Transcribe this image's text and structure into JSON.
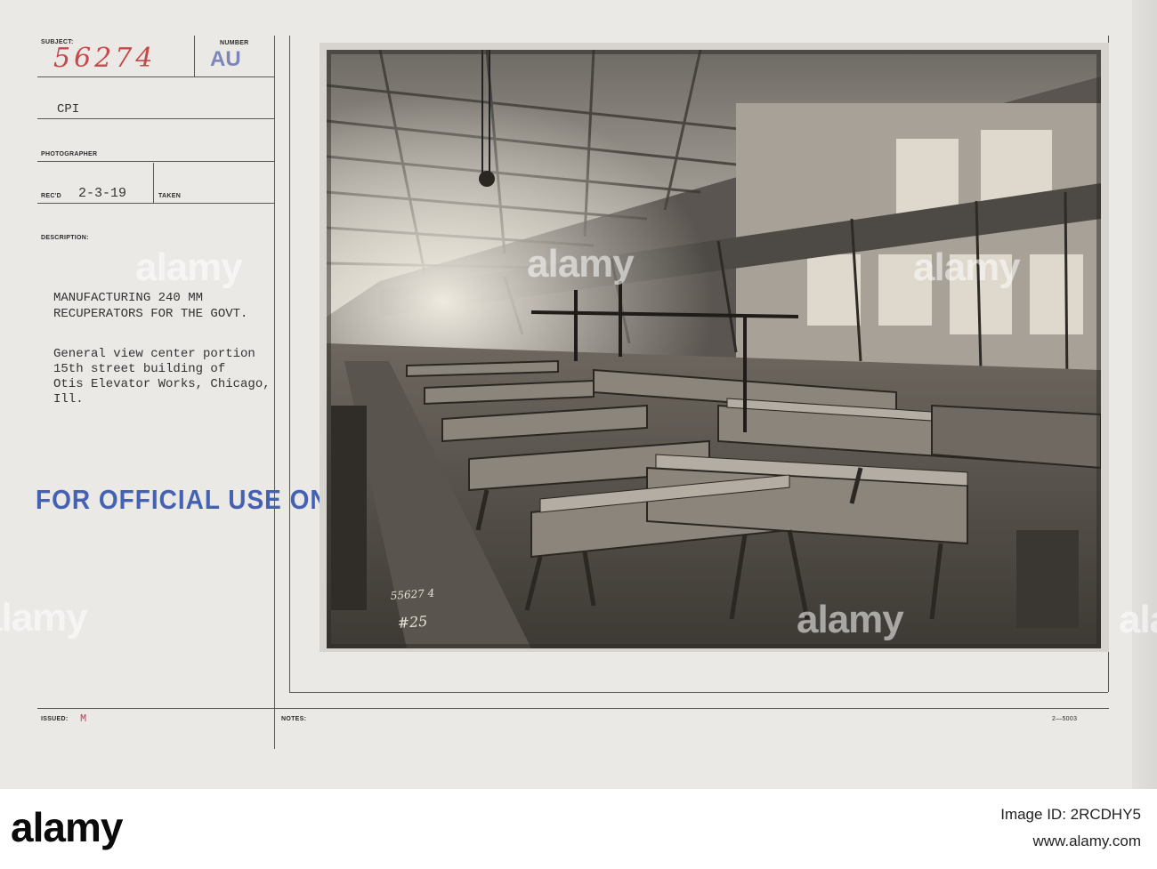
{
  "card": {
    "subject_label": "SUBJECT:",
    "subject_number": "56274",
    "number_label": "NUMBER",
    "number_value": "AU",
    "agency": "CPI",
    "photographer_label": "PHOTOGRAPHER",
    "recd_label": "REC'D",
    "recd_date": "2-3-19",
    "taken_label": "TAKEN",
    "description_label": "DESCRIPTION:",
    "description_lines": [
      "MANUFACTURING 240 MM",
      "RECUPERATORS FOR THE GOVT."
    ],
    "detail_lines": [
      "General view center portion",
      "15th street building of",
      "Otis Elevator Works, Chicago,",
      "Ill."
    ],
    "official_stamp": "FOR OFFICIAL USE ONLY",
    "issued_label": "ISSUED:",
    "issued_value": "M",
    "notes_label": "NOTES:",
    "form_number": "2—5003"
  },
  "photo": {
    "handwritten_id": "55627 4",
    "handwritten_no": "#25"
  },
  "watermarks": [
    "alamy",
    "alamy",
    "alamy",
    "alamy",
    "alamy",
    "alamy"
  ],
  "footer": {
    "logo": "alamy",
    "image_id_line": "Image ID: 2RCDHY5",
    "site": "www.alamy.com"
  }
}
